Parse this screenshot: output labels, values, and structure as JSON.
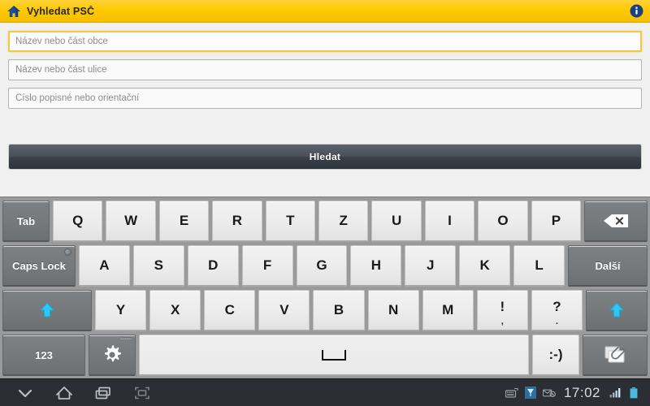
{
  "titlebar": {
    "title": "Vyhledat PSČ",
    "home_icon": "home-icon",
    "info_icon": "info-icon",
    "bg_color": "#fdc900"
  },
  "form": {
    "fields": [
      {
        "name": "obec-field",
        "placeholder": "Název nebo část obce",
        "value": "",
        "focused": true
      },
      {
        "name": "ulice-field",
        "placeholder": "Název nebo část ulice",
        "value": "",
        "focused": false
      },
      {
        "name": "cislo-field",
        "placeholder": "Číslo popisné nebo orientační",
        "value": "",
        "focused": false
      }
    ],
    "search_button": "Hledat"
  },
  "keyboard": {
    "rows": [
      [
        {
          "name": "key-tab",
          "label": "Tab",
          "style": "dark",
          "width": "w-tab"
        },
        {
          "name": "key-q",
          "label": "Q"
        },
        {
          "name": "key-w",
          "label": "W"
        },
        {
          "name": "key-e",
          "label": "E"
        },
        {
          "name": "key-r",
          "label": "R"
        },
        {
          "name": "key-t",
          "label": "T"
        },
        {
          "name": "key-z",
          "label": "Z"
        },
        {
          "name": "key-u",
          "label": "U"
        },
        {
          "name": "key-i",
          "label": "I"
        },
        {
          "name": "key-o",
          "label": "O"
        },
        {
          "name": "key-p",
          "label": "P"
        },
        {
          "name": "key-backspace",
          "label": "",
          "style": "dark",
          "width": "w-bs",
          "icon": "backspace-icon"
        }
      ],
      [
        {
          "name": "key-caps-lock",
          "label": "Caps Lock",
          "style": "dark",
          "width": "w-caps",
          "led": true
        },
        {
          "name": "key-a",
          "label": "A"
        },
        {
          "name": "key-s",
          "label": "S"
        },
        {
          "name": "key-d",
          "label": "D"
        },
        {
          "name": "key-f",
          "label": "F"
        },
        {
          "name": "key-g",
          "label": "G"
        },
        {
          "name": "key-h",
          "label": "H"
        },
        {
          "name": "key-j",
          "label": "J"
        },
        {
          "name": "key-k",
          "label": "K"
        },
        {
          "name": "key-l",
          "label": "L"
        },
        {
          "name": "key-enter-next",
          "label": "Další",
          "style": "dark",
          "width": "w-enter"
        }
      ],
      [
        {
          "name": "key-shift-left",
          "label": "",
          "style": "dark",
          "width": "w-shift-l",
          "icon": "shift-arrow-up-icon"
        },
        {
          "name": "key-y",
          "label": "Y"
        },
        {
          "name": "key-x",
          "label": "X"
        },
        {
          "name": "key-c",
          "label": "C"
        },
        {
          "name": "key-v",
          "label": "V"
        },
        {
          "name": "key-b",
          "label": "B"
        },
        {
          "name": "key-n",
          "label": "N"
        },
        {
          "name": "key-m",
          "label": "M"
        },
        {
          "name": "key-exclam",
          "label": "!",
          "sub": ","
        },
        {
          "name": "key-question",
          "label": "?",
          "sub": "."
        },
        {
          "name": "key-shift-right",
          "label": "",
          "style": "dark",
          "width": "w-shift-r",
          "icon": "shift-arrow-up-icon"
        }
      ],
      [
        {
          "name": "key-numbers",
          "label": "123",
          "style": "dark",
          "width": "w-123"
        },
        {
          "name": "key-settings",
          "label": "",
          "style": "dark",
          "width": "w-gear",
          "icon": "gear-icon",
          "corner_tag": "Nastav."
        },
        {
          "name": "key-space",
          "label": "",
          "style": "space",
          "icon": "space-icon"
        },
        {
          "name": "key-emoji",
          "label": ":-)",
          "width": "w-emoji"
        },
        {
          "name": "key-attach",
          "label": "",
          "style": "dark",
          "width": "w-clip",
          "icon": "paperclip-icon"
        }
      ]
    ]
  },
  "navbar": {
    "buttons": [
      {
        "name": "nav-hide-keyboard",
        "icon": "chevron-down-icon"
      },
      {
        "name": "nav-home",
        "icon": "home-icon"
      },
      {
        "name": "nav-recents",
        "icon": "recents-icon"
      },
      {
        "name": "nav-screenshot",
        "icon": "screenshot-icon"
      }
    ],
    "status_icons": [
      {
        "name": "status-keyboard",
        "icon": "keyboard-icon"
      },
      {
        "name": "status-download",
        "icon": "download-icon"
      },
      {
        "name": "status-mute-message",
        "icon": "mute-message-icon"
      }
    ],
    "clock": "17:02",
    "signal": {
      "name": "status-signal",
      "icon": "signal-bars-icon"
    },
    "battery": {
      "name": "status-battery",
      "icon": "battery-icon"
    }
  }
}
